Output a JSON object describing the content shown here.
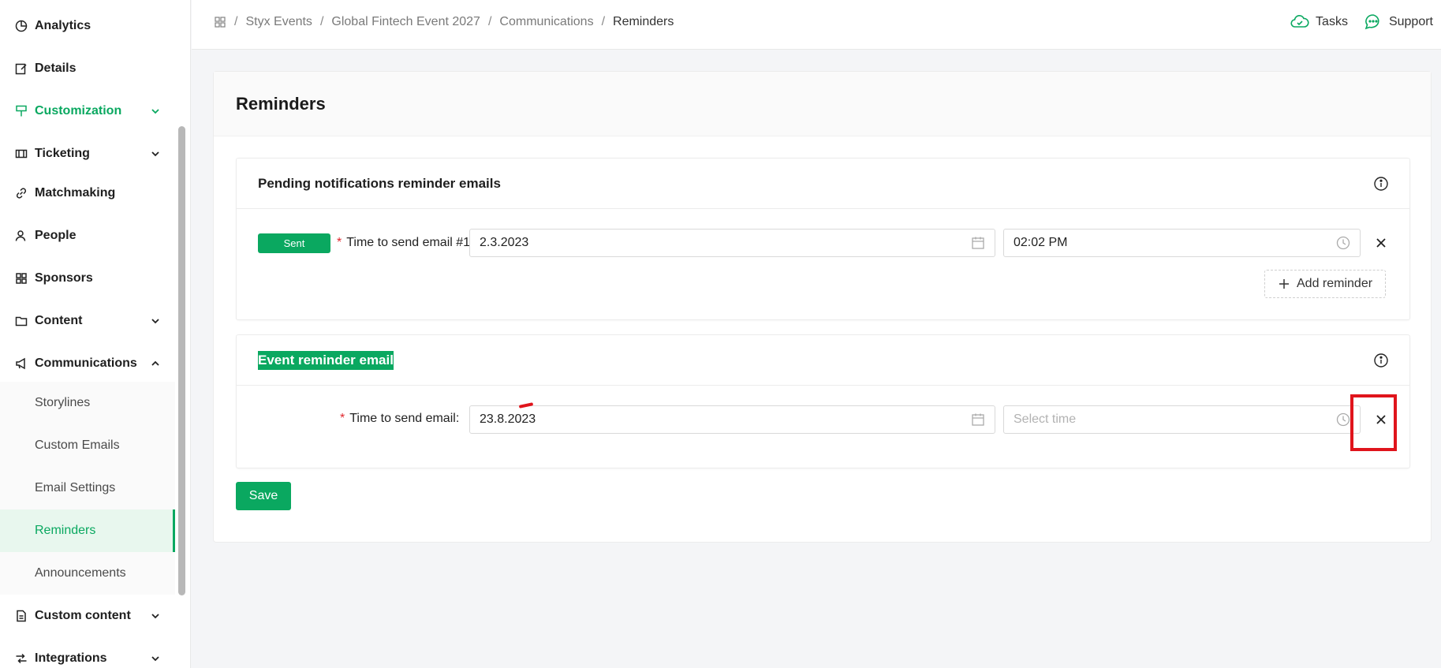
{
  "sidebar": {
    "items": [
      {
        "label": "Analytics",
        "icon": "pie-chart-icon"
      },
      {
        "label": "Details",
        "icon": "edit-icon"
      },
      {
        "label": "Customization",
        "icon": "brush-icon"
      },
      {
        "label": "Ticketing",
        "icon": "ticket-icon"
      },
      {
        "label": "Matchmaking",
        "icon": "link-icon"
      },
      {
        "label": "People",
        "icon": "people-icon"
      },
      {
        "label": "Sponsors",
        "icon": "grid-icon"
      },
      {
        "label": "Content",
        "icon": "folder-icon"
      },
      {
        "label": "Communications",
        "icon": "megaphone-icon"
      },
      {
        "label": "Custom content",
        "icon": "file-icon"
      },
      {
        "label": "Integrations",
        "icon": "integrations-icon"
      }
    ],
    "communications_sub": [
      {
        "label": "Storylines"
      },
      {
        "label": "Custom Emails"
      },
      {
        "label": "Email Settings"
      },
      {
        "label": "Reminders"
      },
      {
        "label": "Announcements"
      }
    ]
  },
  "breadcrumb": [
    "Styx Events",
    "Global Fintech Event 2027",
    "Communications",
    "Reminders"
  ],
  "top_actions": {
    "tasks": "Tasks",
    "support": "Support"
  },
  "page": {
    "title": "Reminders",
    "pending_section": {
      "title": "Pending notifications reminder emails",
      "status_badge": "Sent",
      "label": "Time to send email #1",
      "date_value": "2.3.2023",
      "time_value": "02:02 PM",
      "add_reminder_label": "Add reminder"
    },
    "event_section": {
      "title": "Event reminder email",
      "label": "Time to send email",
      "label_colon": ":",
      "date_value": "23.8.2023",
      "time_placeholder": "Select time"
    },
    "save_label": "Save"
  },
  "colors": {
    "accent": "#0aa860",
    "required": "#e0282e",
    "annotation": "#e0141c"
  }
}
